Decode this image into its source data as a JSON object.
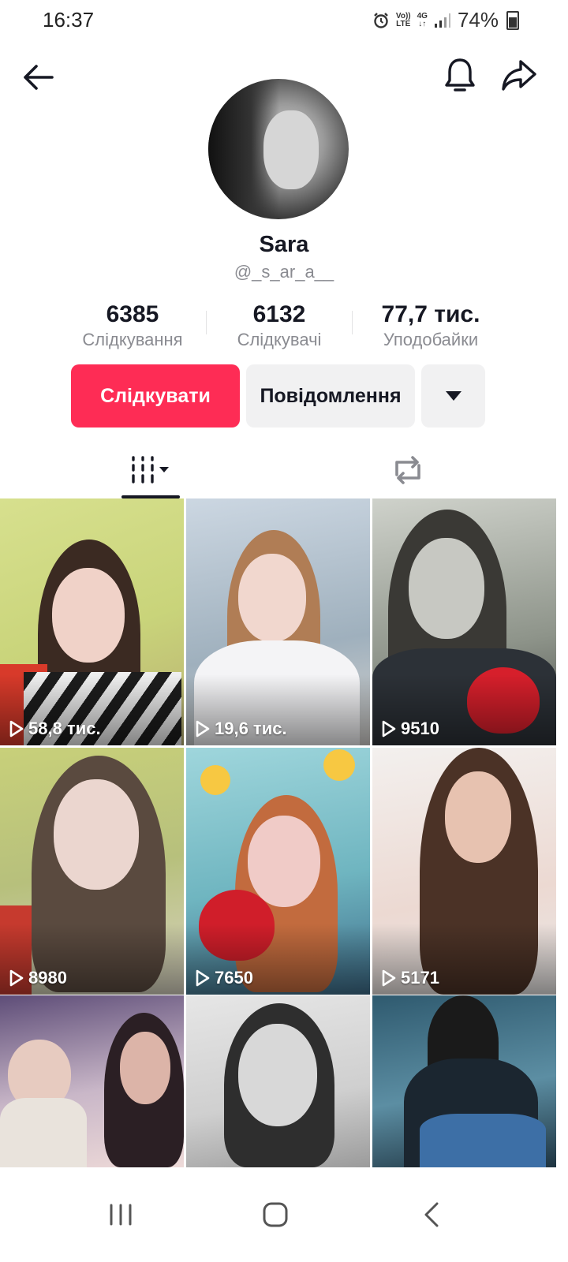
{
  "status_bar": {
    "time": "16:37",
    "volte_label_top": "Vo))",
    "volte_label_bottom": "LTE",
    "network_label": "4G",
    "battery": "74%",
    "icons": [
      "alarm-icon",
      "signal-icon",
      "battery-icon"
    ]
  },
  "header": {
    "icons": [
      "back-arrow-icon",
      "bell-icon",
      "share-icon"
    ]
  },
  "profile": {
    "name": "Sara",
    "handle": "@_s_ar_a__"
  },
  "stats": [
    {
      "value": "6385",
      "label": "Слідкування"
    },
    {
      "value": "6132",
      "label": "Слідкувачі"
    },
    {
      "value": "77,7 тис.",
      "label": "Уподобайки"
    }
  ],
  "actions": {
    "follow_label": "Слідкувати",
    "message_label": "Повідомлення",
    "more_icon": "caret-down-icon"
  },
  "colors": {
    "accent": "#fe2c55",
    "secondary_button": "#f1f1f2",
    "muted_text": "#8a8b91"
  },
  "tabs": [
    {
      "icon": "videos-grid-icon",
      "active": true
    },
    {
      "icon": "repost-icon",
      "active": false
    }
  ],
  "videos": [
    {
      "views": "58,8 тис."
    },
    {
      "views": "19,6 тис."
    },
    {
      "views": "9510"
    },
    {
      "views": "8980"
    },
    {
      "views": "7650"
    },
    {
      "views": "5171"
    },
    {
      "views": ""
    },
    {
      "views": ""
    },
    {
      "views": ""
    }
  ],
  "nav": {
    "icons": [
      "recent-apps-icon",
      "home-icon",
      "back-icon"
    ]
  }
}
